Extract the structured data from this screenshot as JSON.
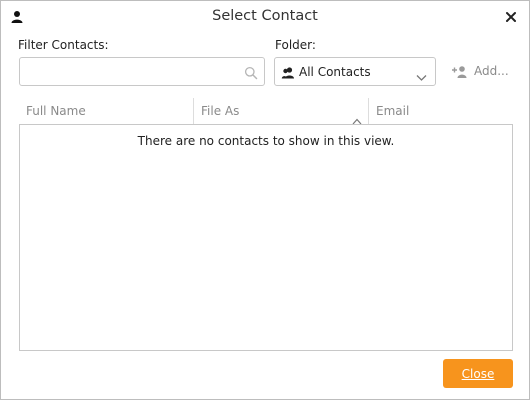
{
  "window": {
    "title": "Select Contact",
    "title_icon": "person-icon",
    "close_icon": "close-icon"
  },
  "filter": {
    "label": "Filter Contacts:",
    "value": "",
    "placeholder": "",
    "icon": "search-icon"
  },
  "folder": {
    "label": "Folder:",
    "selected": "All Contacts",
    "icon": "contacts-icon",
    "dropdown_icon": "chevron-down-icon"
  },
  "add": {
    "label": "Add...",
    "icon": "add-contact-icon"
  },
  "table": {
    "columns": [
      {
        "label": "Full Name"
      },
      {
        "label": "File As",
        "sort": "ascending"
      },
      {
        "label": "Email"
      }
    ],
    "rows": [],
    "empty_message": "There are no contacts to show in this view."
  },
  "footer": {
    "close_label": "Close"
  },
  "colors": {
    "accent": "#f7941d",
    "border": "#c8c8c8",
    "muted_text": "#8a8a8a"
  }
}
